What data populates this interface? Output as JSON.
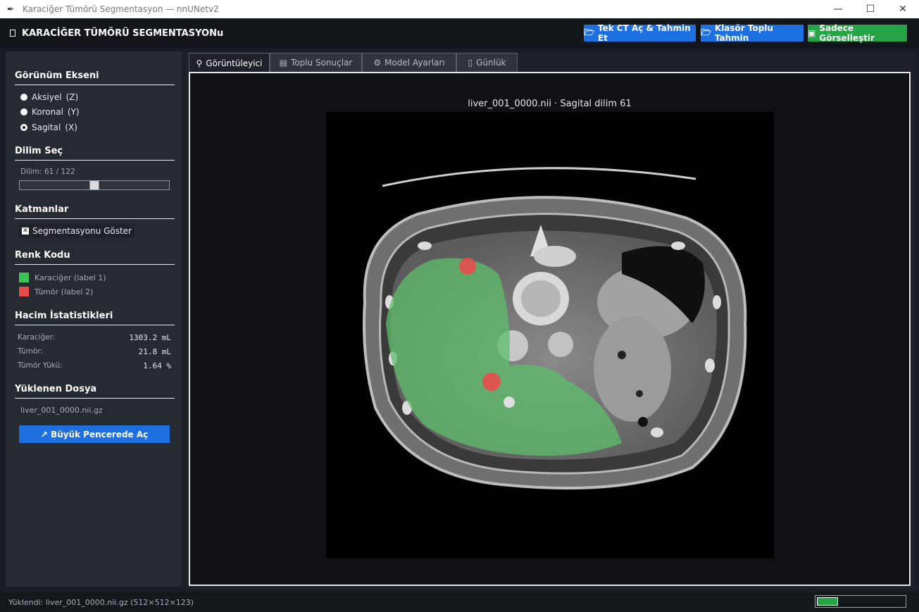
{
  "window": {
    "title": "Karaciğer Tümörü Segmentasyon — nnUNetv2",
    "app_icon": "feather-icon",
    "controls": [
      "—",
      "☐",
      "✕"
    ]
  },
  "header": {
    "title": "KARACİĞER TÜMÖRÜ SEGMENTASYONu",
    "buttons": {
      "open_single": "Tek CT Aç & Tahmin Et",
      "folder_batch": "Klasör Toplu Tahmin",
      "visualize_only": "Sadece Görselleştir"
    },
    "colors": {
      "blue": "#1e6fe0",
      "green": "#27a348"
    }
  },
  "sidebar": {
    "view_axis": {
      "title": "Görünüm Ekseni",
      "options": [
        {
          "label": "Aksiyel",
          "key": "(Z)",
          "selected": false
        },
        {
          "label": "Koronal",
          "key": "(Y)",
          "selected": false
        },
        {
          "label": "Sagital",
          "key": "(X)",
          "selected": true
        }
      ]
    },
    "slice": {
      "title": "Dilim Seç",
      "label": "Dilim: 61 / 122",
      "current": 61,
      "max": 122
    },
    "layers": {
      "title": "Katmanlar",
      "show_seg_label": "Segmentasyonu Göster",
      "show_seg_checked": true
    },
    "color_code": {
      "title": "Renk Kodu",
      "items": [
        {
          "label": "Karaciğer (label 1)",
          "color": "#3ec25a"
        },
        {
          "label": "Tümör (label 2)",
          "color": "#e84b4b"
        }
      ]
    },
    "volume_stats": {
      "title": "Hacim İstatistikleri",
      "rows": [
        {
          "label": "Karaciğer:",
          "value": "1303.2 mL"
        },
        {
          "label": "Tümör:",
          "value": "21.8 mL"
        },
        {
          "label": "Tümör Yükü:",
          "value": "1.64 %"
        }
      ]
    },
    "loaded_file": {
      "title": "Yüklenen Dosya",
      "name": "liver_001_0000.nii.gz",
      "open_big_label": "↗ Büyük Pencerede Aç"
    }
  },
  "tabs": [
    {
      "label": "Görüntüleyici",
      "icon": "microscope-icon",
      "active": true
    },
    {
      "label": "Toplu Sonuçlar",
      "icon": "table-icon",
      "active": false
    },
    {
      "label": "Model Ayarları",
      "icon": "gear-icon",
      "active": false
    },
    {
      "label": "Günlük",
      "icon": "log-icon",
      "active": false
    }
  ],
  "viewer": {
    "caption": "liver_001_0000.nii  ·  Sagital dilim 61"
  },
  "status": {
    "text": "Yüklendi: liver_001_0000.nii.gz  (512×512×123)",
    "progress": 0.24
  }
}
